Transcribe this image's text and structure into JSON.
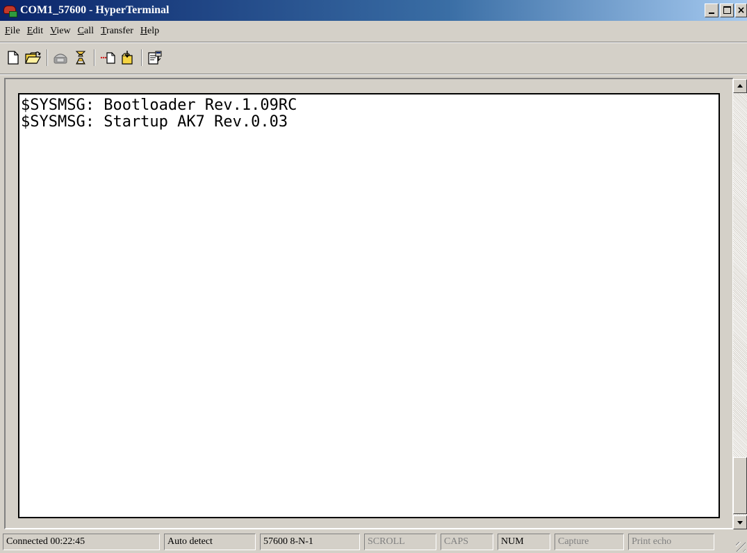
{
  "window": {
    "title": "COM1_57600 - HyperTerminal",
    "icon": "hyperterminal-phone-icon"
  },
  "menu": [
    {
      "key": "F",
      "rest": "ile"
    },
    {
      "key": "E",
      "rest": "dit"
    },
    {
      "key": "V",
      "rest": "iew"
    },
    {
      "key": "C",
      "rest": "all"
    },
    {
      "key": "T",
      "rest": "ransfer"
    },
    {
      "key": "H",
      "rest": "elp"
    }
  ],
  "toolbar": {
    "icons": [
      "new-icon",
      "open-icon",
      "disconnect-icon",
      "dial-icon",
      "send-icon",
      "receive-icon",
      "properties-icon"
    ]
  },
  "terminal": {
    "lines": [
      "$SYSMSG: Bootloader Rev.1.09RC",
      "$SYSMSG: Startup AK7 Rev.0.03"
    ]
  },
  "status": {
    "connected": "Connected 00:22:45",
    "detect": "Auto detect",
    "settings": "57600 8-N-1",
    "scroll": "SCROLL",
    "caps": "CAPS",
    "num": "NUM",
    "capture": "Capture",
    "print_echo": "Print echo"
  },
  "colors": {
    "titlebar_start": "#0a246a",
    "titlebar_end": "#a6caf0",
    "face": "#d4d0c8"
  }
}
